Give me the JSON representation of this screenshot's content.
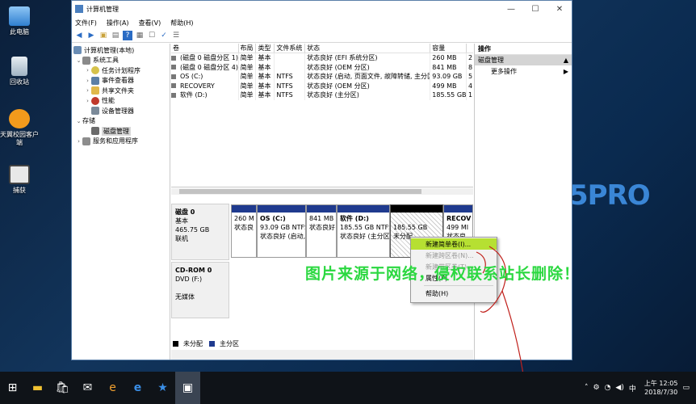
{
  "desktop": {
    "icons": [
      {
        "label": "此电脑"
      },
      {
        "label": "回收站"
      },
      {
        "label": "天翼校园客户端"
      },
      {
        "label": "捕获"
      }
    ],
    "brand": "5PRO"
  },
  "window": {
    "title": "计算机管理",
    "menu": [
      "文件(F)",
      "操作(A)",
      "查看(V)",
      "帮助(H)"
    ]
  },
  "tree": [
    {
      "label": "计算机管理(本地)",
      "tw": "",
      "level": 0
    },
    {
      "label": "系统工具",
      "tw": "⌄",
      "level": 1
    },
    {
      "label": "任务计划程序",
      "tw": "›",
      "level": 2
    },
    {
      "label": "事件查看器",
      "tw": "›",
      "level": 2
    },
    {
      "label": "共享文件夹",
      "tw": "›",
      "level": 2
    },
    {
      "label": "性能",
      "tw": "›",
      "level": 2
    },
    {
      "label": "设备管理器",
      "tw": "",
      "level": 2
    },
    {
      "label": "存储",
      "tw": "⌄",
      "level": 1
    },
    {
      "label": "磁盘管理",
      "tw": "",
      "level": 2
    },
    {
      "label": "服务和应用程序",
      "tw": "›",
      "level": 1
    }
  ],
  "volumes": {
    "headers": [
      "卷",
      "布局",
      "类型",
      "文件系统",
      "状态",
      "容量",
      ""
    ],
    "rows": [
      [
        "(磁盘 0 磁盘分区 1)",
        "简单",
        "基本",
        "",
        "状态良好 (EFI 系统分区)",
        "260 MB",
        "2"
      ],
      [
        "(磁盘 0 磁盘分区 4)",
        "简单",
        "基本",
        "",
        "状态良好 (OEM 分区)",
        "841 MB",
        "8"
      ],
      [
        "OS (C:)",
        "简单",
        "基本",
        "NTFS",
        "状态良好 (启动, 页面文件, 故障转储, 主分区)",
        "93.09 GB",
        "5"
      ],
      [
        "RECOVERY",
        "简单",
        "基本",
        "NTFS",
        "状态良好 (OEM 分区)",
        "499 MB",
        "4"
      ],
      [
        "软件 (D:)",
        "简单",
        "基本",
        "NTFS",
        "状态良好 (主分区)",
        "185.55 GB",
        "1"
      ]
    ]
  },
  "disk0": {
    "name": "磁盘 0",
    "type": "基本",
    "size": "465.75 GB",
    "status": "联机",
    "partitions": [
      {
        "title": "",
        "l1": "260 M",
        "l2": "状态良"
      },
      {
        "title": "OS  (C:)",
        "l1": "93.09 GB NTFS",
        "l2": "状态良好 (启动,"
      },
      {
        "title": "",
        "l1": "841 MB",
        "l2": "状态良好"
      },
      {
        "title": "软件  (D:)",
        "l1": "185.55 GB NTFS",
        "l2": "状态良好 (主分区"
      },
      {
        "title": "",
        "l1": "185.55 GB",
        "l2": "未分配"
      },
      {
        "title": "RECOV",
        "l1": "499 MI",
        "l2": "状态良"
      }
    ]
  },
  "cdrom": {
    "name": "CD-ROM 0",
    "type": "DVD (F:)",
    "media": "无媒体"
  },
  "legend": {
    "unalloc": "未分配",
    "primary": "主分区"
  },
  "actions": {
    "header": "操作",
    "section": "磁盘管理",
    "more": "更多操作"
  },
  "context_menu": [
    "新建简单卷(I)...",
    "新建跨区卷(N)...",
    "新建带区卷(T)...",
    "属性(P)",
    "帮助(H)"
  ],
  "watermark": "图片来源于网络，侵权联系站长删除！",
  "taskbar": {
    "tray_lang": "中",
    "time": "上午 12:05",
    "date": "2018/7/30"
  }
}
